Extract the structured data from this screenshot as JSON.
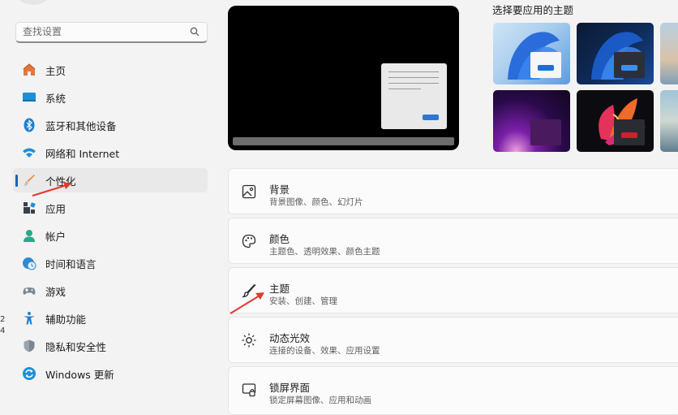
{
  "search": {
    "placeholder": "查找设置"
  },
  "sidebar": {
    "items": [
      {
        "label": "主页",
        "icon": "home-icon"
      },
      {
        "label": "系统",
        "icon": "system-icon"
      },
      {
        "label": "蓝牙和其他设备",
        "icon": "bluetooth-icon"
      },
      {
        "label": "网络和 Internet",
        "icon": "wifi-icon"
      },
      {
        "label": "个性化",
        "icon": "brush-icon"
      },
      {
        "label": "应用",
        "icon": "apps-icon"
      },
      {
        "label": "帐户",
        "icon": "account-icon"
      },
      {
        "label": "时间和语言",
        "icon": "clock-globe-icon"
      },
      {
        "label": "游戏",
        "icon": "gamepad-icon"
      },
      {
        "label": "辅助功能",
        "icon": "accessibility-icon"
      },
      {
        "label": "隐私和安全性",
        "icon": "shield-icon"
      },
      {
        "label": "Windows 更新",
        "icon": "update-icon"
      }
    ]
  },
  "themes": {
    "title": "选择要应用的主题"
  },
  "cards": [
    {
      "title": "背景",
      "subtitle": "背景图像、颜色、幻灯片",
      "icon": "image-icon"
    },
    {
      "title": "颜色",
      "subtitle": "主题色、透明效果、颜色主题",
      "icon": "palette-icon"
    },
    {
      "title": "主题",
      "subtitle": "安装、创建、管理",
      "icon": "brush-icon"
    },
    {
      "title": "动态光效",
      "subtitle": "连接的设备、效果、应用设置",
      "icon": "light-effect-icon"
    },
    {
      "title": "锁屏界面",
      "subtitle": "锁定屏幕图像、应用和动画",
      "icon": "lock-screen-icon"
    }
  ],
  "edge_marks": [
    "2",
    "4"
  ],
  "colors": {
    "accent": "#0067c0",
    "annotation": "#e03a2f"
  }
}
